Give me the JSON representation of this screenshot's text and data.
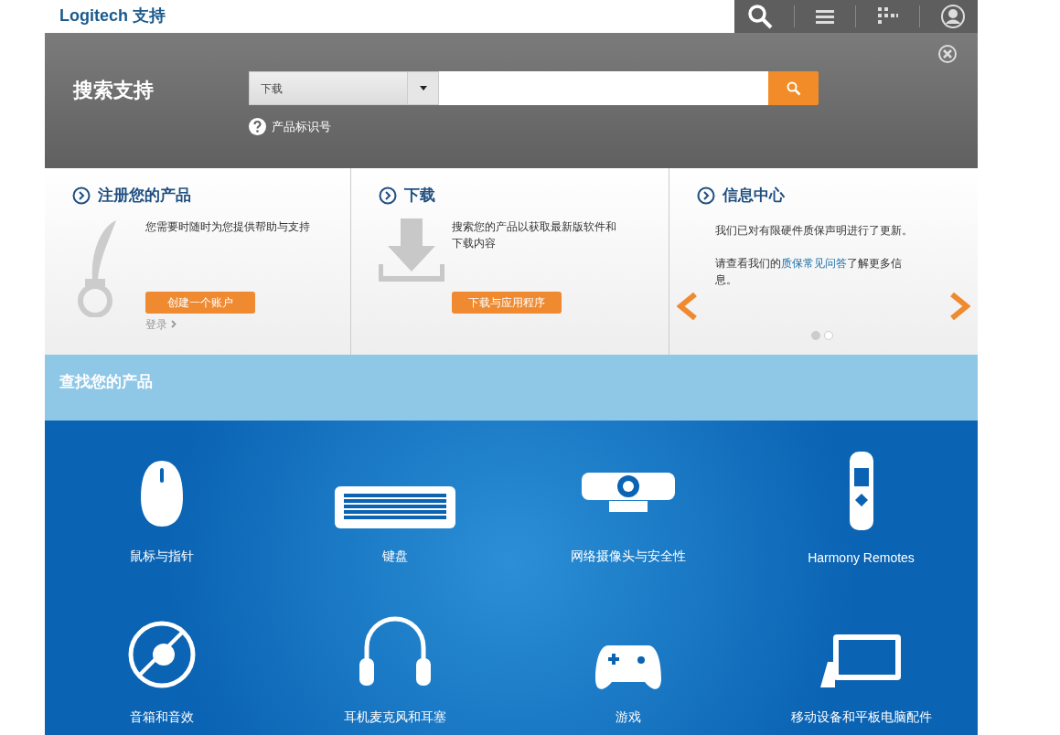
{
  "header": {
    "brand": "Logitech",
    "brand_suffix": "支持"
  },
  "search": {
    "title": "搜索支持",
    "category": "下载",
    "product_id_link": "产品标识号"
  },
  "cards": [
    {
      "kind": "register",
      "title": "注册您的产品",
      "text": "您需要时随时为您提供帮助与支持",
      "button": "创建一个账户",
      "link": "登录"
    },
    {
      "kind": "download",
      "title": "下载",
      "text": "搜索您的产品以获取最新版软件和下载内容",
      "button": "下载与应用程序"
    },
    {
      "kind": "info",
      "title": "信息中心",
      "text": "我们已对有限硬件质保声明进行了更新。",
      "text2_before": "请查看我们的",
      "text2_link": "质保常见问答",
      "text2_after": "了解更多信息。",
      "dots": [
        {
          "selected": true
        },
        {
          "selected": false
        }
      ]
    }
  ],
  "find_products": {
    "title": "查找您的产品"
  },
  "products": [
    {
      "kind": "mouse",
      "label": "鼠标与指针"
    },
    {
      "kind": "keyboard",
      "label": "键盘"
    },
    {
      "kind": "webcam",
      "label": "网络摄像头与安全性"
    },
    {
      "kind": "remote",
      "label": "Harmony Remotes"
    },
    {
      "kind": "speaker",
      "label": "音箱和音效"
    },
    {
      "kind": "headset",
      "label": "耳机麦克风和耳塞"
    },
    {
      "kind": "gamepad",
      "label": "游戏"
    },
    {
      "kind": "tablet",
      "label": "移动设备和平板电脑配件"
    }
  ]
}
